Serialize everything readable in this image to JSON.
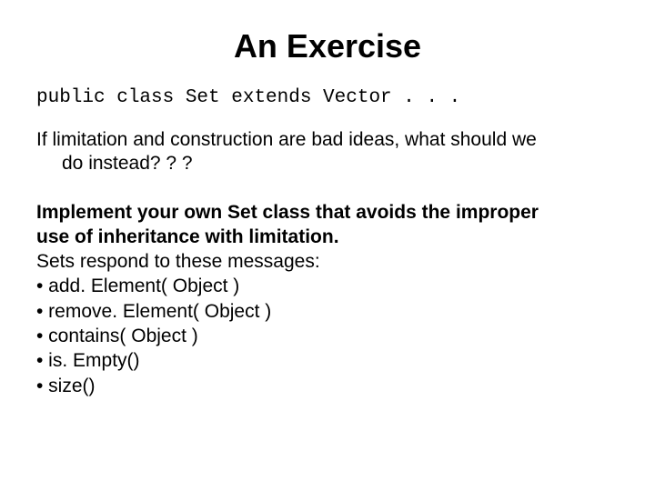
{
  "title": "An Exercise",
  "code": "public class Set extends Vector . . .",
  "question_line1": "If limitation and construction are bad ideas, what should we",
  "question_line2": "do instead? ? ?",
  "instr_line1": "Implement your own Set class that avoids the improper",
  "instr_line2": "use of inheritance with limitation.",
  "respond": "Sets respond to these messages:",
  "bullets": {
    "b1": "• add. Element( Object )",
    "b2": "• remove. Element( Object )",
    "b3": "• contains( Object )",
    "b4": "• is. Empty()",
    "b5": "• size()"
  }
}
